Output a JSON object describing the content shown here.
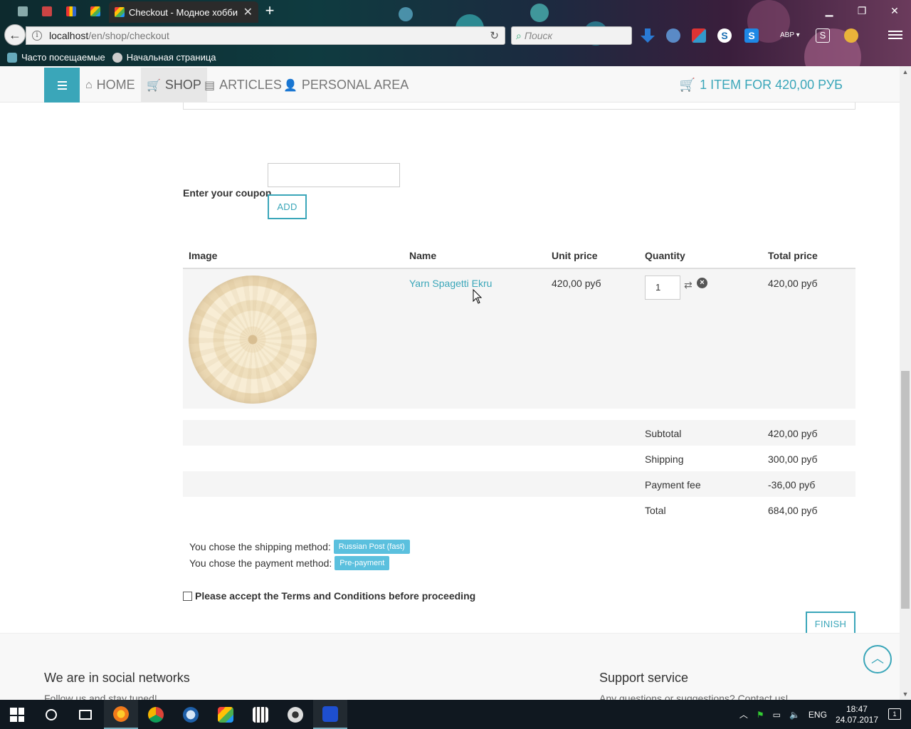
{
  "browser": {
    "tab_title": "Checkout - Модное хобби",
    "url_host": "localhost",
    "url_path": "/en/shop/checkout",
    "search_placeholder": "Поиск",
    "bookmarks": [
      "Часто посещаемые",
      "Начальная страница"
    ],
    "toolbar_badge": "ABP"
  },
  "nav": {
    "items": [
      {
        "label": "HOME",
        "icon": "home-icon"
      },
      {
        "label": "SHOP",
        "icon": "cart-icon"
      },
      {
        "label": "ARTICLES",
        "icon": "document-icon"
      },
      {
        "label": "PERSONAL AREA",
        "icon": "user-icon"
      }
    ],
    "cart_summary": "1 ITEM FOR 420,00 РУБ"
  },
  "coupon": {
    "label": "Enter your coupon",
    "value": "",
    "add_label": "ADD"
  },
  "cart": {
    "headers": [
      "Image",
      "Name",
      "Unit price",
      "Quantity",
      "Total price"
    ],
    "items": [
      {
        "name": "Yarn Spagetti Ekru",
        "unit_price": "420,00 руб",
        "quantity": "1",
        "total_price": "420,00 руб"
      }
    ]
  },
  "totals": [
    {
      "label": "Subtotal",
      "value": "420,00 руб"
    },
    {
      "label": "Shipping",
      "value": "300,00 руб"
    },
    {
      "label": "Payment fee",
      "value": "-36,00 руб"
    },
    {
      "label": "Total",
      "value": "684,00 руб"
    }
  ],
  "methods": {
    "shipping_text": "You chose the shipping method:",
    "shipping_value": "Russian Post (fast)",
    "payment_text": "You chose the payment method:",
    "payment_value": "Pre-payment"
  },
  "terms_label": "Please accept the Terms and Conditions before proceeding",
  "finish_label": "FINISH",
  "footer": {
    "left_title": "We are in social networks",
    "left_text": "Follow us and stay tuned!",
    "right_title": "Support service",
    "right_text": "Any questions or suggestions? Contact us!"
  },
  "taskbar": {
    "lang": "ENG",
    "time": "18:47",
    "date": "24.07.2017",
    "notifications": "1"
  },
  "colors": {
    "accent": "#3aa6b9",
    "badge": "#5bc0de"
  }
}
